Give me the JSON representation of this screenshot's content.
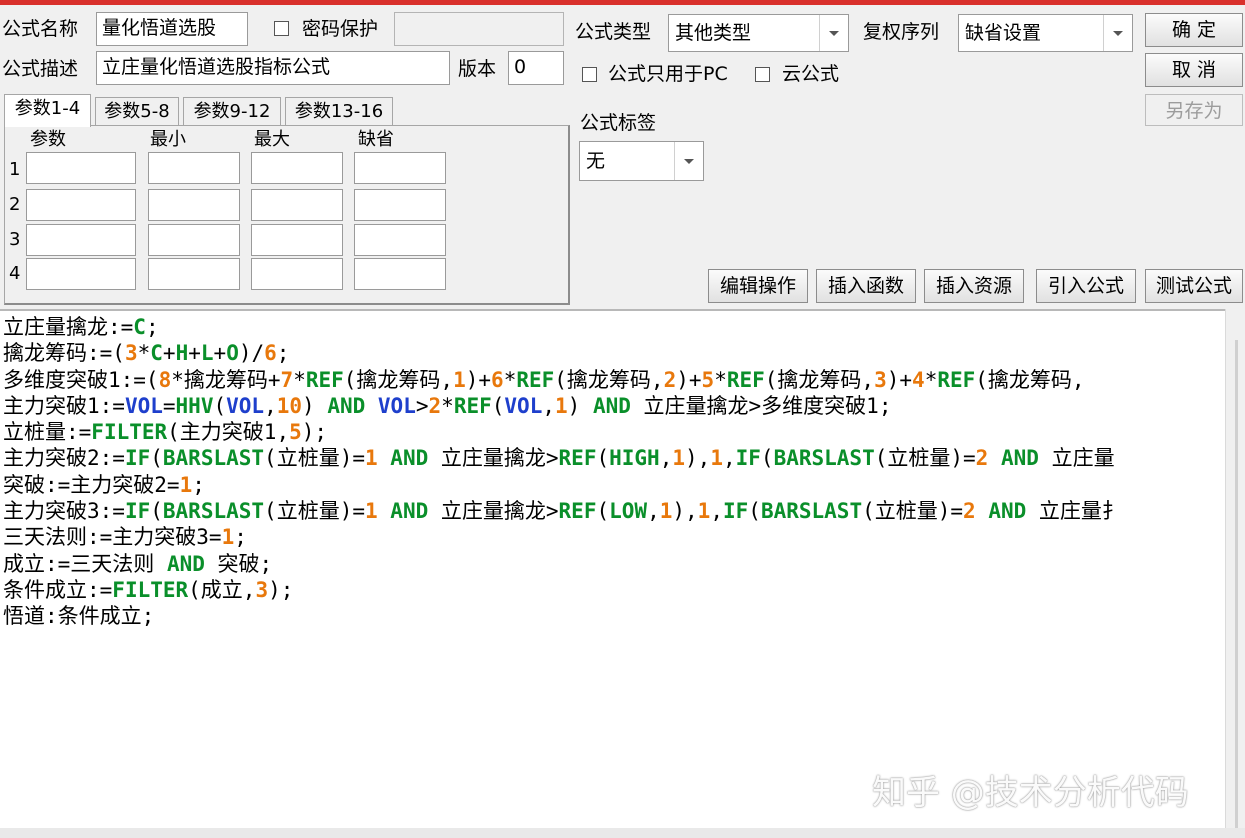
{
  "header": {
    "name_label": "公式名称",
    "name_value": "量化悟道选股",
    "password_label": "密码保护",
    "password_value": "",
    "desc_label": "公式描述",
    "desc_value": "立庄量化悟道选股指标公式",
    "version_label": "版本",
    "version_value": "0",
    "type_label": "公式类型",
    "type_value": "其他类型",
    "rights_label": "复权序列",
    "rights_value": "缺省设置",
    "pc_only_label": "公式只用于PC",
    "cloud_label": "云公式",
    "tag_label": "公式标签",
    "tag_value": "无"
  },
  "buttons": {
    "ok": "确  定",
    "cancel": "取  消",
    "save_as": "另存为",
    "edit_op": "编辑操作",
    "insert_func": "插入函数",
    "insert_res": "插入资源",
    "import_formula": "引入公式",
    "test_formula": "测试公式"
  },
  "params": {
    "tabs": [
      "参数1-4",
      "参数5-8",
      "参数9-12",
      "参数13-16"
    ],
    "columns": [
      "参数",
      "最小",
      "最大",
      "缺省"
    ],
    "rows": [
      "1",
      "2",
      "3",
      "4"
    ]
  },
  "colors": {
    "keyword": "#0a8f2a",
    "number": "#e8780c",
    "variable": "#1e3fcc",
    "text": "#000000",
    "accent_bar": "#d9302c"
  },
  "code_lines": [
    [
      [
        "立庄量擒龙:=",
        "t"
      ],
      [
        "C",
        "k"
      ],
      [
        ";",
        "t"
      ]
    ],
    [
      [
        "擒龙筹码:=(",
        "t"
      ],
      [
        "3",
        "n"
      ],
      [
        "*",
        "t"
      ],
      [
        "C",
        "k"
      ],
      [
        "+",
        "t"
      ],
      [
        "H",
        "k"
      ],
      [
        "+",
        "t"
      ],
      [
        "L",
        "k"
      ],
      [
        "+",
        "t"
      ],
      [
        "O",
        "k"
      ],
      [
        ")/",
        "t"
      ],
      [
        "6",
        "n"
      ],
      [
        ";",
        "t"
      ]
    ],
    [
      [
        "多维度突破1:=(",
        "t"
      ],
      [
        "8",
        "n"
      ],
      [
        "*擒龙筹码+",
        "t"
      ],
      [
        "7",
        "n"
      ],
      [
        "*",
        "t"
      ],
      [
        "REF",
        "k"
      ],
      [
        "(擒龙筹码,",
        "t"
      ],
      [
        "1",
        "n"
      ],
      [
        ")+",
        "t"
      ],
      [
        "6",
        "n"
      ],
      [
        "*",
        "t"
      ],
      [
        "REF",
        "k"
      ],
      [
        "(擒龙筹码,",
        "t"
      ],
      [
        "2",
        "n"
      ],
      [
        ")+",
        "t"
      ],
      [
        "5",
        "n"
      ],
      [
        "*",
        "t"
      ],
      [
        "REF",
        "k"
      ],
      [
        "(擒龙筹码,",
        "t"
      ],
      [
        "3",
        "n"
      ],
      [
        ")+",
        "t"
      ],
      [
        "4",
        "n"
      ],
      [
        "*",
        "t"
      ],
      [
        "REF",
        "k"
      ],
      [
        "(擒龙筹码,",
        "t"
      ]
    ],
    [
      [
        "主力突破1:=",
        "t"
      ],
      [
        "VOL",
        "v"
      ],
      [
        "=",
        "t"
      ],
      [
        "HHV",
        "k"
      ],
      [
        "(",
        "t"
      ],
      [
        "VOL",
        "v"
      ],
      [
        ",",
        "t"
      ],
      [
        "10",
        "n"
      ],
      [
        ") ",
        "t"
      ],
      [
        "AND",
        "k"
      ],
      [
        " ",
        "t"
      ],
      [
        "VOL",
        "v"
      ],
      [
        ">",
        "t"
      ],
      [
        "2",
        "n"
      ],
      [
        "*",
        "t"
      ],
      [
        "REF",
        "k"
      ],
      [
        "(",
        "t"
      ],
      [
        "VOL",
        "v"
      ],
      [
        ",",
        "t"
      ],
      [
        "1",
        "n"
      ],
      [
        ") ",
        "t"
      ],
      [
        "AND",
        "k"
      ],
      [
        " 立庄量擒龙>多维度突破1;",
        "t"
      ]
    ],
    [
      [
        "立桩量:=",
        "t"
      ],
      [
        "FILTER",
        "k"
      ],
      [
        "(主力突破1,",
        "t"
      ],
      [
        "5",
        "n"
      ],
      [
        ");",
        "t"
      ]
    ],
    [
      [
        "主力突破2:=",
        "t"
      ],
      [
        "IF",
        "k"
      ],
      [
        "(",
        "t"
      ],
      [
        "BARSLAST",
        "k"
      ],
      [
        "(立桩量)=",
        "t"
      ],
      [
        "1",
        "n"
      ],
      [
        " ",
        "t"
      ],
      [
        "AND",
        "k"
      ],
      [
        " 立庄量擒龙>",
        "t"
      ],
      [
        "REF",
        "k"
      ],
      [
        "(",
        "t"
      ],
      [
        "HIGH",
        "k"
      ],
      [
        ",",
        "t"
      ],
      [
        "1",
        "n"
      ],
      [
        "),",
        "t"
      ],
      [
        "1",
        "n"
      ],
      [
        ",",
        "t"
      ],
      [
        "IF",
        "k"
      ],
      [
        "(",
        "t"
      ],
      [
        "BARSLAST",
        "k"
      ],
      [
        "(立桩量)=",
        "t"
      ],
      [
        "2",
        "n"
      ],
      [
        " ",
        "t"
      ],
      [
        "AND",
        "k"
      ],
      [
        " 立庄量",
        "t"
      ]
    ],
    [
      [
        "突破:=主力突破2=",
        "t"
      ],
      [
        "1",
        "n"
      ],
      [
        ";",
        "t"
      ]
    ],
    [
      [
        "主力突破3:=",
        "t"
      ],
      [
        "IF",
        "k"
      ],
      [
        "(",
        "t"
      ],
      [
        "BARSLAST",
        "k"
      ],
      [
        "(立桩量)=",
        "t"
      ],
      [
        "1",
        "n"
      ],
      [
        " ",
        "t"
      ],
      [
        "AND",
        "k"
      ],
      [
        " 立庄量擒龙>",
        "t"
      ],
      [
        "REF",
        "k"
      ],
      [
        "(",
        "t"
      ],
      [
        "LOW",
        "k"
      ],
      [
        ",",
        "t"
      ],
      [
        "1",
        "n"
      ],
      [
        "),",
        "t"
      ],
      [
        "1",
        "n"
      ],
      [
        ",",
        "t"
      ],
      [
        "IF",
        "k"
      ],
      [
        "(",
        "t"
      ],
      [
        "BARSLAST",
        "k"
      ],
      [
        "(立桩量)=",
        "t"
      ],
      [
        "2",
        "n"
      ],
      [
        " ",
        "t"
      ],
      [
        "AND",
        "k"
      ],
      [
        " 立庄量扌",
        "t"
      ]
    ],
    [
      [
        "三天法则:=主力突破3=",
        "t"
      ],
      [
        "1",
        "n"
      ],
      [
        ";",
        "t"
      ]
    ],
    [
      [
        "成立:=三天法则 ",
        "t"
      ],
      [
        "AND",
        "k"
      ],
      [
        " 突破;",
        "t"
      ]
    ],
    [
      [
        "条件成立:=",
        "t"
      ],
      [
        "FILTER",
        "k"
      ],
      [
        "(成立,",
        "t"
      ],
      [
        "3",
        "n"
      ],
      [
        ");",
        "t"
      ]
    ],
    [
      [
        "悟道:条件成立;",
        "t"
      ]
    ]
  ],
  "watermark": "知乎 @技术分析代码"
}
